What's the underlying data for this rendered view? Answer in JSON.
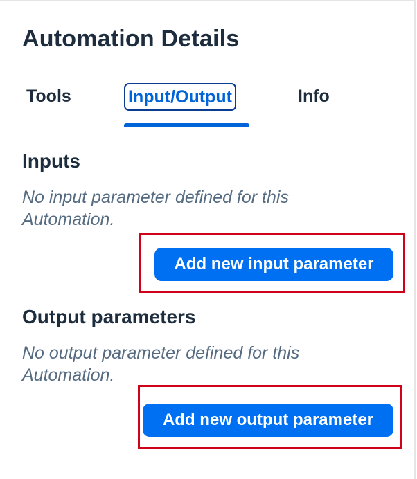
{
  "header": {
    "title": "Automation Details"
  },
  "tabs": [
    {
      "label": "Tools",
      "selected": false
    },
    {
      "label": "Input/Output",
      "selected": true
    },
    {
      "label": "Info",
      "selected": false
    }
  ],
  "inputs": {
    "heading": "Inputs",
    "empty_text": "No input parameter defined for this Automation.",
    "button_label": "Add new input parameter"
  },
  "outputs": {
    "heading": "Output parameters",
    "empty_text": "No output parameter defined for this Automation.",
    "button_label": "Add new output parameter"
  },
  "colors": {
    "accent": "#0070f2",
    "highlight": "#d0021b",
    "text": "#1d2d3e",
    "muted_text": "#556b82"
  }
}
